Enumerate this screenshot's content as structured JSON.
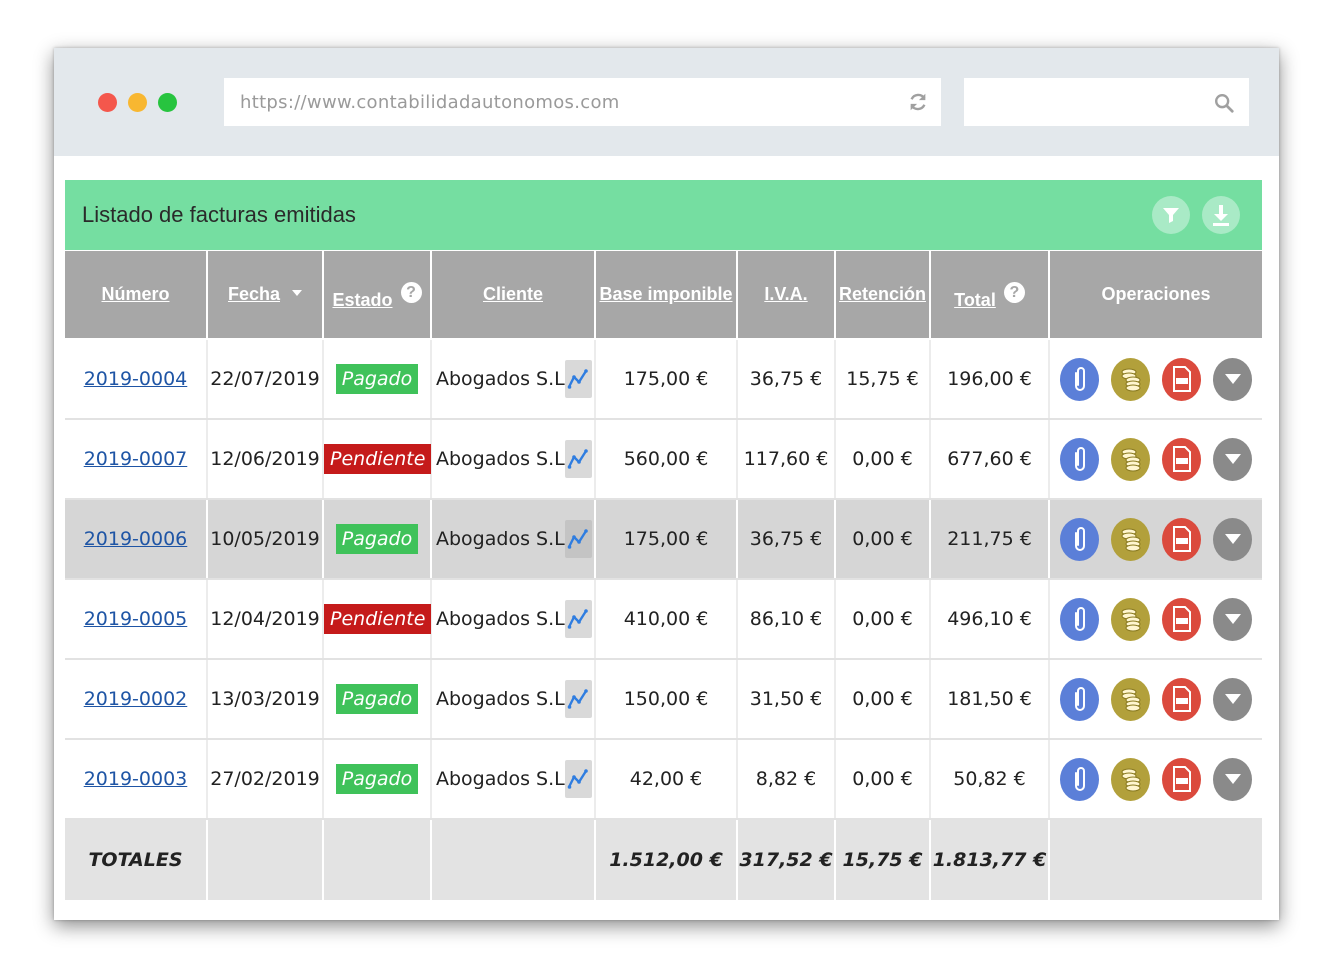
{
  "browser": {
    "url": "https://www.contabilidadautonomos.com",
    "search_value": ""
  },
  "panel": {
    "title": "Listado de facturas emitidas"
  },
  "table": {
    "headers": {
      "numero": "Número",
      "fecha": "Fecha",
      "estado": "Estado",
      "cliente": "Cliente",
      "base": "Base imponible",
      "iva": "I.V.A.",
      "retencion": "Retención",
      "total": "Total",
      "operaciones": "Operaciones"
    },
    "rows": [
      {
        "numero": "2019-0004",
        "fecha": "22/07/2019",
        "estado": "Pagado",
        "estado_type": "paid",
        "cliente": "Abogados S.L",
        "base": "175,00 €",
        "iva": "36,75 €",
        "retencion": "15,75 €",
        "total": "196,00 €"
      },
      {
        "numero": "2019-0007",
        "fecha": "12/06/2019",
        "estado": "Pendiente",
        "estado_type": "pending",
        "cliente": "Abogados S.L",
        "base": "560,00 €",
        "iva": "117,60 €",
        "retencion": "0,00 €",
        "total": "677,60 €"
      },
      {
        "numero": "2019-0006",
        "fecha": "10/05/2019",
        "estado": "Pagado",
        "estado_type": "paid",
        "cliente": "Abogados S.L",
        "base": "175,00 €",
        "iva": "36,75 €",
        "retencion": "0,00 €",
        "total": "211,75 €"
      },
      {
        "numero": "2019-0005",
        "fecha": "12/04/2019",
        "estado": "Pendiente",
        "estado_type": "pending",
        "cliente": "Abogados S.L",
        "base": "410,00 €",
        "iva": "86,10 €",
        "retencion": "0,00 €",
        "total": "496,10 €"
      },
      {
        "numero": "2019-0002",
        "fecha": "13/03/2019",
        "estado": "Pagado",
        "estado_type": "paid",
        "cliente": "Abogados S.L",
        "base": "150,00 €",
        "iva": "31,50 €",
        "retencion": "0,00 €",
        "total": "181,50 €"
      },
      {
        "numero": "2019-0003",
        "fecha": "27/02/2019",
        "estado": "Pagado",
        "estado_type": "paid",
        "cliente": "Abogados S.L",
        "base": "42,00 €",
        "iva": "8,82 €",
        "retencion": "0,00 €",
        "total": "50,82 €"
      }
    ],
    "totals": {
      "label": "TOTALES",
      "base": "1.512,00 €",
      "iva": "317,52 €",
      "retencion": "15,75 €",
      "total": "1.813,77 €"
    }
  },
  "colors": {
    "header_green": "#75dea1",
    "paid": "#3fc25a",
    "pending": "#c51a1a",
    "link": "#1f55a5"
  },
  "icons": {
    "filter": "filter-icon",
    "download": "download-icon",
    "stats": "chart-line-icon",
    "attach": "paperclip-icon",
    "payments": "coins-icon",
    "pdf": "pdf-icon",
    "more": "chevron-down-icon"
  }
}
